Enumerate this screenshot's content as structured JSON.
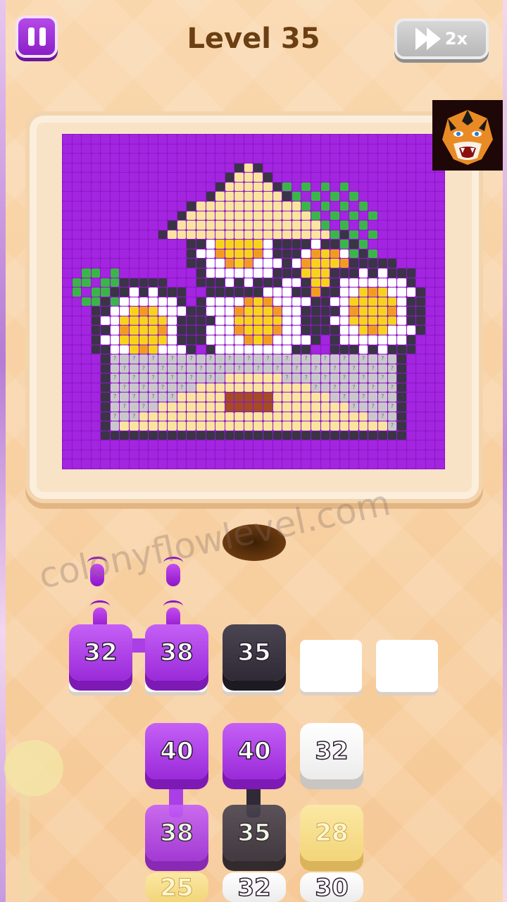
{
  "header": {
    "level_title": "Level 35",
    "speed_label": "2x",
    "pause_icon": "pause-icon",
    "speed_icon": "fast-forward-icon"
  },
  "watermark": "colonyflowlevel.com",
  "colors": {
    "purple": "#9a2ad9",
    "dark": "#2f2a36",
    "background": "#f6c996",
    "board_bg": "#8d18c9"
  },
  "slots": [
    {
      "value": "32",
      "color": "purple",
      "filled": true
    },
    {
      "value": "38",
      "color": "purple",
      "filled": true
    },
    {
      "value": "35",
      "color": "dark",
      "filled": true
    },
    {
      "value": "",
      "color": "white",
      "filled": false
    },
    {
      "value": "",
      "color": "white",
      "filled": false
    }
  ],
  "stack": {
    "row1": [
      {
        "value": "40",
        "color": "purple"
      },
      {
        "value": "40",
        "color": "purple"
      },
      {
        "value": "32",
        "color": "white"
      }
    ],
    "row2": [
      {
        "value": "38",
        "color": "purple"
      },
      {
        "value": "35",
        "color": "dark"
      },
      {
        "value": "28",
        "color": "yellow"
      }
    ],
    "row3": [
      {
        "value": "25",
        "color": "yellow"
      },
      {
        "value": "32",
        "color": "white"
      },
      {
        "value": "30",
        "color": "white"
      }
    ]
  }
}
